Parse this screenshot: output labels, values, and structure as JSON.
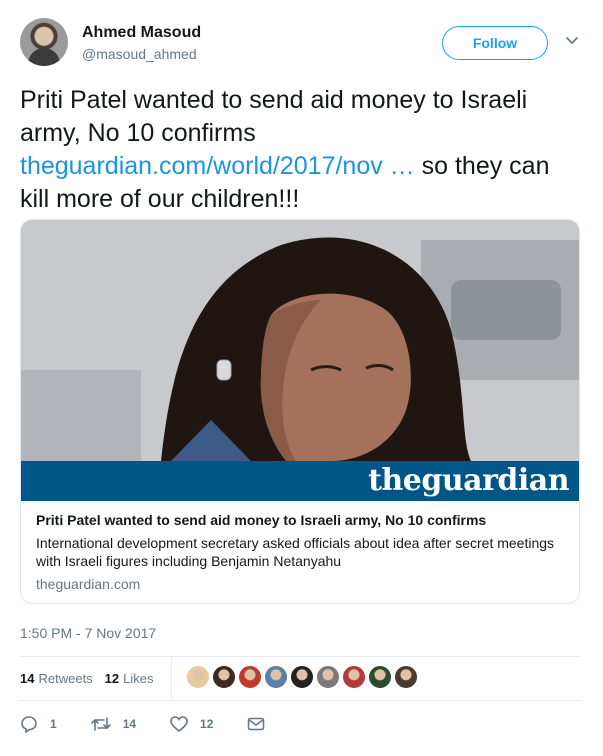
{
  "author": {
    "name": "Ahmed Masoud",
    "handle": "@masoud_ahmed",
    "avatar_icon": "user-avatar"
  },
  "follow_button": {
    "label": "Follow",
    "color": "#1da1f2"
  },
  "tweet": {
    "text_before": "Priti Patel wanted to send aid money to Israeli army, No 10 confirms ",
    "link_text": "theguardian.com/world/2017/nov …",
    "text_after": " so they can kill more of our children!!!",
    "link_color": "#1b95e0"
  },
  "card": {
    "brand_the": "the",
    "brand_guardian": "guardian",
    "brand_color": "#005689",
    "title": "Priti Patel wanted to send aid money to Israeli army, No 10 confirms",
    "description": "International development secretary asked officials about idea after secret meetings with Israeli figures including Benjamin Netanyahu",
    "domain": "theguardian.com"
  },
  "timestamp": "1:50 PM - 7 Nov 2017",
  "stats": {
    "retweets_count": "14",
    "retweets_label": "Retweets",
    "likes_count": "12",
    "likes_label": "Likes"
  },
  "likers": [
    {
      "color": "#e8c9a0"
    },
    {
      "color": "#3a2a22"
    },
    {
      "color": "#c0392b"
    },
    {
      "color": "#5a7fa8"
    },
    {
      "color": "#222222"
    },
    {
      "color": "#7a7a7a"
    },
    {
      "color": "#b33a3a"
    },
    {
      "color": "#2e4a2e"
    },
    {
      "color": "#4a3a30"
    }
  ],
  "actions": {
    "reply_count": "1",
    "retweet_count": "14",
    "like_count": "12",
    "reply_icon": "reply-icon",
    "retweet_icon": "retweet-icon",
    "like_icon": "heart-icon",
    "dm_icon": "envelope-icon"
  }
}
